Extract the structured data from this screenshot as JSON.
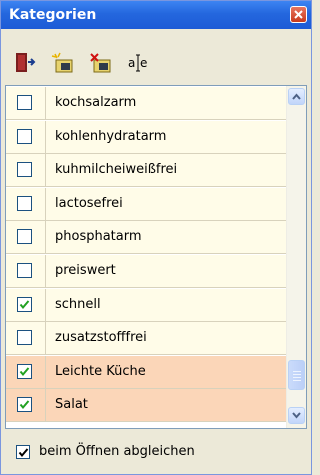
{
  "window": {
    "title": "Kategorien"
  },
  "toolbar": {
    "buttons": [
      {
        "icon": "door-exit-icon"
      },
      {
        "icon": "new-category-icon"
      },
      {
        "icon": "delete-category-icon"
      },
      {
        "icon": "rename-icon",
        "text": "a|e"
      }
    ]
  },
  "list": {
    "items": [
      {
        "label": "kochsalzarm",
        "checked": false,
        "highlight": false
      },
      {
        "label": "kohlenhydratarm",
        "checked": false,
        "highlight": false
      },
      {
        "label": "kuhmilcheiweißfrei",
        "checked": false,
        "highlight": false
      },
      {
        "label": "lactosefrei",
        "checked": false,
        "highlight": false
      },
      {
        "label": "phosphatarm",
        "checked": false,
        "highlight": false
      },
      {
        "label": "preiswert",
        "checked": false,
        "highlight": false
      },
      {
        "label": "schnell",
        "checked": true,
        "highlight": false
      },
      {
        "label": "zusatzstofffrei",
        "checked": false,
        "highlight": false
      },
      {
        "label": "Leichte Küche",
        "checked": true,
        "highlight": true
      },
      {
        "label": "Salat",
        "checked": true,
        "highlight": true
      }
    ]
  },
  "footer": {
    "sync_label": "beim Öffnen abgleichen",
    "sync_checked": true
  },
  "colors": {
    "check_green": "#21A121",
    "highlight_row": "#FBD6B8",
    "row_bg": "#FFFCE8"
  }
}
